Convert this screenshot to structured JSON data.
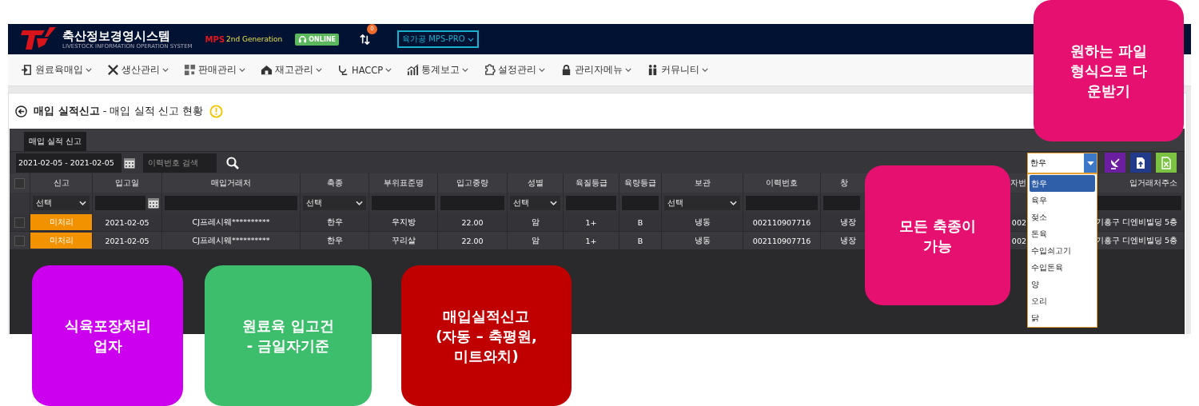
{
  "header": {
    "brand": "축산정보경영시스템",
    "brand_subtitle": "LIVESTOCK INFORMATION OPERATION SYSTEM",
    "mps": "MPS",
    "generation": "2nd Generation",
    "online": "ONLINE",
    "notification_count": "0",
    "company": "육가공 MPS-PRO"
  },
  "menu": [
    {
      "label": "원료육매입"
    },
    {
      "label": "생산관리"
    },
    {
      "label": "판매관리"
    },
    {
      "label": "재고관리"
    },
    {
      "label": "HACCP"
    },
    {
      "label": "통계보고"
    },
    {
      "label": "설정관리"
    },
    {
      "label": "관리자메뉴"
    },
    {
      "label": "커뮤니티"
    }
  ],
  "page_title": "**매입 실적신고** - 매입 실적 신고 현황",
  "tabs": [
    {
      "label": "매입 실적 신고",
      "selected": true
    }
  ],
  "toolbar": {
    "date_range": "2021-02-05 - 2021-02-05",
    "search_placeholder": "이력번호 검색"
  },
  "species_dropdown": {
    "value": "한우",
    "expanded": true,
    "options": [
      {
        "label": "한우",
        "selected": true
      },
      {
        "label": "육우",
        "selected": false
      },
      {
        "label": "젖소",
        "selected": false
      },
      {
        "label": "돈육",
        "selected": false
      },
      {
        "label": "수입쇠고기",
        "selected": false
      },
      {
        "label": "수입돈육",
        "selected": false
      },
      {
        "label": "양",
        "selected": false
      },
      {
        "label": "오리",
        "selected": false
      },
      {
        "label": "닭",
        "selected": false
      }
    ]
  },
  "table": {
    "select_all_checked": false,
    "columns": [
      {
        "label": "신고",
        "kind": "status",
        "filter": {
          "kind": "select",
          "value": "선택"
        }
      },
      {
        "label": "입고일",
        "kind": "text",
        "filter": {
          "kind": "date"
        }
      },
      {
        "label": "매입거래처",
        "kind": "text",
        "filter": {
          "kind": "text"
        }
      },
      {
        "label": "축종",
        "kind": "text",
        "filter": {
          "kind": "select",
          "value": "선택"
        }
      },
      {
        "label": "부위표준명",
        "kind": "text",
        "filter": {
          "kind": "text"
        }
      },
      {
        "label": "입고중량",
        "kind": "text",
        "filter": {
          "kind": "text"
        }
      },
      {
        "label": "성별",
        "kind": "text",
        "filter": {
          "kind": "select",
          "value": "선택"
        }
      },
      {
        "label": "육질등급",
        "kind": "text",
        "filter": {
          "kind": "text"
        }
      },
      {
        "label": "육량등급",
        "kind": "text",
        "filter": {
          "kind": "text"
        }
      },
      {
        "label": "보관",
        "kind": "text",
        "filter": {
          "kind": "select",
          "value": "선택"
        }
      },
      {
        "label": "이력번호",
        "kind": "text",
        "filter": {
          "kind": "text"
        }
      },
      {
        "label": "창",
        "kind": "text",
        "filter": {
          "kind": "text"
        }
      },
      {
        "label": "자번",
        "kind": "text",
        "filter": {
          "kind": "none"
        }
      },
      {
        "label": "입거래처주소",
        "kind": "text",
        "filter": {
          "kind": "text"
        }
      }
    ],
    "rows": [
      {
        "checked": false,
        "cells": [
          "미처리",
          "2021-02-05",
          "CJ프레시웨**********",
          "한우",
          "우지방",
          "22.00",
          "암",
          "1+",
          "B",
          "냉동",
          "002110907716",
          "냉장",
          "002",
          "기흥구 디엔비빌딩 5층"
        ]
      },
      {
        "checked": false,
        "cells": [
          "미처리",
          "2021-02-05",
          "CJ프레시웨**********",
          "한우",
          "꾸리살",
          "22.00",
          "암",
          "1+",
          "B",
          "냉동",
          "002110907716",
          "냉장",
          "002",
          "기흥구 디엔비빌딩 5층"
        ]
      }
    ]
  },
  "callouts": [
    {
      "text": "원하는 파일\n형식으로 다\n운받기",
      "color": "#e5106f"
    },
    {
      "text": "모든 축종이\n가능",
      "color": "#e5106f"
    },
    {
      "text": "식육포장처리\n업자",
      "color": "#cc00ee"
    },
    {
      "text": "원료육 입고건\n- 금일자기준",
      "color": "#3dbe6c"
    },
    {
      "text": "매입실적신고\n(자동 – 축평원,\n미트와치)",
      "color": "#c00000"
    }
  ]
}
